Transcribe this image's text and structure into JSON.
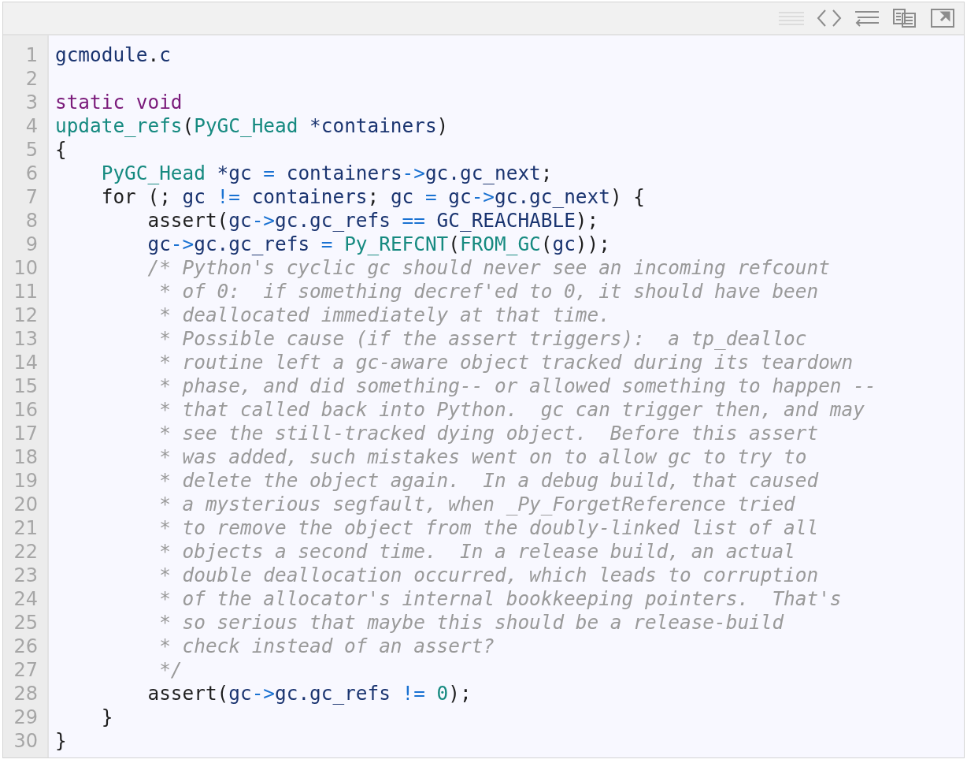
{
  "code_lines": [
    {
      "number": "1",
      "tokens": [
        {
          "kind": "ident",
          "text": "gcmodule"
        },
        {
          "kind": "punct",
          "text": "."
        },
        {
          "kind": "ident",
          "text": "c"
        }
      ]
    },
    {
      "number": "2"
    },
    {
      "number": "3",
      "tokens": [
        {
          "kind": "keyword",
          "text": "static void"
        }
      ]
    },
    {
      "number": "4",
      "tokens": [
        {
          "kind": "type",
          "text": "update_refs"
        },
        {
          "kind": "punct",
          "text": "("
        },
        {
          "kind": "type",
          "text": "PyGC_Head"
        },
        {
          "kind": "ident",
          "text": " *containers"
        },
        {
          "kind": "punct",
          "text": ")"
        }
      ]
    },
    {
      "number": "5",
      "tokens": [
        {
          "kind": "punct",
          "text": "{"
        }
      ]
    },
    {
      "number": "6",
      "tokens": [
        {
          "kind": "type",
          "text": "    PyGC_Head"
        },
        {
          "kind": "ident",
          "text": " *gc "
        },
        {
          "kind": "op",
          "text": "="
        },
        {
          "kind": "ident",
          "text": " containers"
        },
        {
          "kind": "op",
          "text": "->"
        },
        {
          "kind": "ident",
          "text": "gc.gc_next"
        },
        {
          "kind": "punct",
          "text": ";"
        }
      ]
    },
    {
      "number": "7",
      "tokens": [
        {
          "kind": "punct",
          "text": "    for (; "
        },
        {
          "kind": "ident",
          "text": "gc "
        },
        {
          "kind": "op",
          "text": "!="
        },
        {
          "kind": "ident",
          "text": " containers"
        },
        {
          "kind": "punct",
          "text": "; "
        },
        {
          "kind": "ident",
          "text": "gc "
        },
        {
          "kind": "op",
          "text": "="
        },
        {
          "kind": "ident",
          "text": " gc"
        },
        {
          "kind": "op",
          "text": "->"
        },
        {
          "kind": "ident",
          "text": "gc.gc_next"
        },
        {
          "kind": "punct",
          "text": ") {"
        }
      ]
    },
    {
      "number": "8",
      "tokens": [
        {
          "kind": "punct",
          "text": "        assert("
        },
        {
          "kind": "ident",
          "text": "gc"
        },
        {
          "kind": "op",
          "text": "->"
        },
        {
          "kind": "ident",
          "text": "gc.gc_refs "
        },
        {
          "kind": "op",
          "text": "=="
        },
        {
          "kind": "ident",
          "text": " GC_REACHABLE"
        },
        {
          "kind": "punct",
          "text": ");"
        }
      ]
    },
    {
      "number": "9",
      "tokens": [
        {
          "kind": "ident",
          "text": "        gc"
        },
        {
          "kind": "op",
          "text": "->"
        },
        {
          "kind": "ident",
          "text": "gc.gc_refs "
        },
        {
          "kind": "op",
          "text": "="
        },
        {
          "kind": "type",
          "text": " Py_REFCNT"
        },
        {
          "kind": "punct",
          "text": "("
        },
        {
          "kind": "type",
          "text": "FROM_GC"
        },
        {
          "kind": "punct",
          "text": "("
        },
        {
          "kind": "ident",
          "text": "gc"
        },
        {
          "kind": "punct",
          "text": "));"
        }
      ]
    },
    {
      "number": "10",
      "tokens": [
        {
          "kind": "comment",
          "text": "        /* Python's cyclic gc should never see an incoming refcount"
        }
      ]
    },
    {
      "number": "11",
      "tokens": [
        {
          "kind": "comment",
          "text": "         * of 0:  if something decref'ed to 0, it should have been"
        }
      ]
    },
    {
      "number": "12",
      "tokens": [
        {
          "kind": "comment",
          "text": "         * deallocated immediately at that time."
        }
      ]
    },
    {
      "number": "13",
      "tokens": [
        {
          "kind": "comment",
          "text": "         * Possible cause (if the assert triggers):  a tp_dealloc"
        }
      ]
    },
    {
      "number": "14",
      "tokens": [
        {
          "kind": "comment",
          "text": "         * routine left a gc-aware object tracked during its teardown"
        }
      ]
    },
    {
      "number": "15",
      "tokens": [
        {
          "kind": "comment",
          "text": "         * phase, and did something-- or allowed something to happen --"
        }
      ]
    },
    {
      "number": "16",
      "tokens": [
        {
          "kind": "comment",
          "text": "         * that called back into Python.  gc can trigger then, and may"
        }
      ]
    },
    {
      "number": "17",
      "tokens": [
        {
          "kind": "comment",
          "text": "         * see the still-tracked dying object.  Before this assert"
        }
      ]
    },
    {
      "number": "18",
      "tokens": [
        {
          "kind": "comment",
          "text": "         * was added, such mistakes went on to allow gc to try to"
        }
      ]
    },
    {
      "number": "19",
      "tokens": [
        {
          "kind": "comment",
          "text": "         * delete the object again.  In a debug build, that caused"
        }
      ]
    },
    {
      "number": "20",
      "tokens": [
        {
          "kind": "comment",
          "text": "         * a mysterious segfault, when _Py_ForgetReference tried"
        }
      ]
    },
    {
      "number": "21",
      "tokens": [
        {
          "kind": "comment",
          "text": "         * to remove the object from the doubly-linked list of all"
        }
      ]
    },
    {
      "number": "22",
      "tokens": [
        {
          "kind": "comment",
          "text": "         * objects a second time.  In a release build, an actual"
        }
      ]
    },
    {
      "number": "23",
      "tokens": [
        {
          "kind": "comment",
          "text": "         * double deallocation occurred, which leads to corruption"
        }
      ]
    },
    {
      "number": "24",
      "tokens": [
        {
          "kind": "comment",
          "text": "         * of the allocator's internal bookkeeping pointers.  That's"
        }
      ]
    },
    {
      "number": "25",
      "tokens": [
        {
          "kind": "comment",
          "text": "         * so serious that maybe this should be a release-build"
        }
      ]
    },
    {
      "number": "26",
      "tokens": [
        {
          "kind": "comment",
          "text": "         * check instead of an assert?"
        }
      ]
    },
    {
      "number": "27",
      "tokens": [
        {
          "kind": "comment",
          "text": "         */"
        }
      ]
    },
    {
      "number": "28",
      "tokens": [
        {
          "kind": "punct",
          "text": "        assert("
        },
        {
          "kind": "ident",
          "text": "gc"
        },
        {
          "kind": "op",
          "text": "->"
        },
        {
          "kind": "ident",
          "text": "gc.gc_refs "
        },
        {
          "kind": "op",
          "text": "!="
        },
        {
          "kind": "number",
          "text": " 0"
        },
        {
          "kind": "punct",
          "text": ");"
        }
      ]
    },
    {
      "number": "29",
      "tokens": [
        {
          "kind": "punct",
          "text": "    }"
        }
      ]
    },
    {
      "number": "30",
      "tokens": [
        {
          "kind": "punct",
          "text": "}"
        }
      ]
    }
  ]
}
